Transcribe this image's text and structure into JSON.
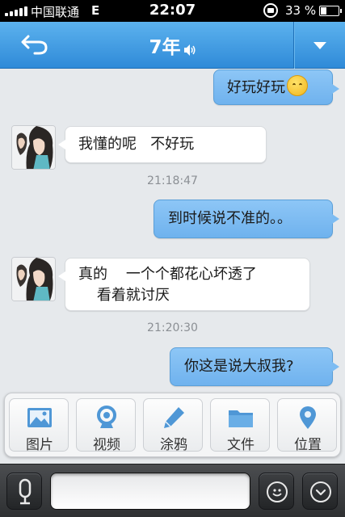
{
  "status_bar": {
    "carrier": "中国联通",
    "network": "E",
    "time": "22:07",
    "battery_percent_label": "33 %",
    "battery_level": 0.33
  },
  "nav": {
    "title": "7年",
    "back_icon": "back-arrow-icon",
    "speaker_icon": "speaker-icon",
    "menu_icon": "dropdown-triangle-icon",
    "color": "#3a94dd"
  },
  "messages": [
    {
      "side": "out",
      "text": "好玩好玩",
      "emoji": "grinning-face-icon"
    },
    {
      "side": "in",
      "text": "我懂的呢   不好玩"
    },
    {
      "side": "time",
      "text": "21:18:47"
    },
    {
      "side": "out",
      "text": "到时候说不准的。。"
    },
    {
      "side": "in",
      "text": "真的    一个个都花心坏透了\n    看着就讨厌"
    },
    {
      "side": "time",
      "text": "21:20:30"
    },
    {
      "side": "out",
      "text": "你这是说大叔我?"
    }
  ],
  "tools": [
    {
      "label": "图片",
      "icon": "image-icon"
    },
    {
      "label": "视频",
      "icon": "video-icon"
    },
    {
      "label": "涂鸦",
      "icon": "pencil-icon"
    },
    {
      "label": "文件",
      "icon": "folder-icon"
    },
    {
      "label": "位置",
      "icon": "location-pin-icon"
    }
  ],
  "input_bar": {
    "voice_icon": "microphone-icon",
    "emoji_icon": "smiley-icon",
    "collapse_icon": "chevron-down-icon",
    "placeholder": ""
  }
}
